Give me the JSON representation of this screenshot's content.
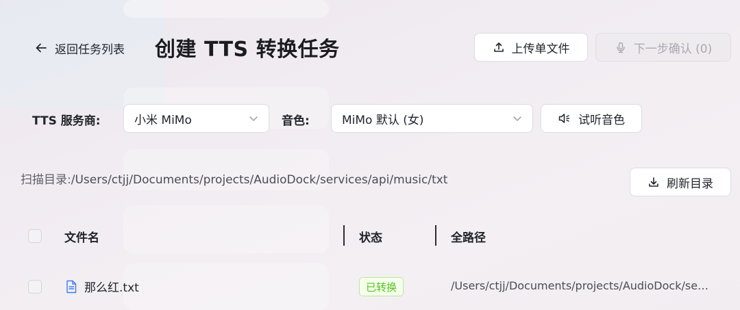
{
  "header": {
    "back_label": "返回任务列表",
    "title": "创建 TTS 转换任务",
    "upload_label": "上传单文件",
    "next_label": "下一步确认 (0)"
  },
  "config": {
    "provider_label": "TTS 服务商:",
    "provider_value": "小米 MiMo",
    "voice_label": "音色:",
    "voice_value": "MiMo 默认 (女)",
    "preview_label": "试听音色"
  },
  "scan": {
    "label": "扫描目录:",
    "path": "/Users/ctjj/Documents/projects/AudioDock/services/api/music/txt",
    "refresh_label": "刷新目录"
  },
  "table": {
    "columns": [
      "文件名",
      "状态",
      "全路径"
    ],
    "rows": [
      {
        "name": "那么红.txt",
        "status": "已转换",
        "path": "/Users/ctjj/Documents/projects/AudioDock/servi..."
      }
    ]
  },
  "colors": {
    "success_text": "#52c41a",
    "success_bg": "#f6ffed",
    "success_border": "#b7eb8f"
  }
}
